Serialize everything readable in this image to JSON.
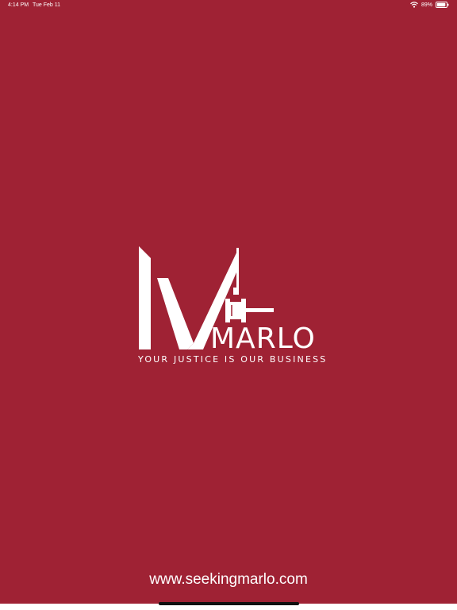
{
  "status_bar": {
    "time": "4:14 PM",
    "date": "Tue Feb 11",
    "battery_percent": "89%",
    "icons": [
      "wifi-icon",
      "battery-icon"
    ]
  },
  "logo": {
    "icon": "gavel-m-logo-icon",
    "brand_name": "MARLO",
    "tagline": "YOUR JUSTICE IS OUR BUSINESS"
  },
  "footer": {
    "website": "www.seekingmarlo.com"
  },
  "colors": {
    "background": "#9f2234",
    "foreground": "#ffffff"
  }
}
